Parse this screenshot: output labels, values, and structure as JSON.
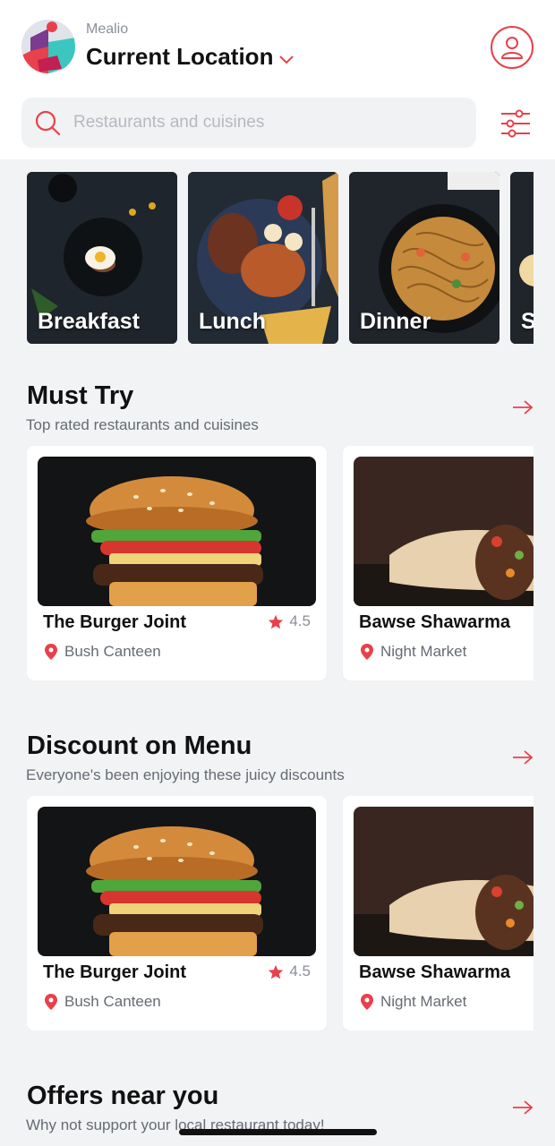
{
  "header": {
    "app_name": "Mealio",
    "location_label": "Current Location"
  },
  "search": {
    "placeholder": "Restaurants and cuisines"
  },
  "categories": [
    {
      "label": "Breakfast"
    },
    {
      "label": "Lunch"
    },
    {
      "label": "Dinner"
    },
    {
      "label": "S"
    }
  ],
  "must_try": {
    "title": "Must Try",
    "subtitle": "Top rated restaurants and cuisines",
    "cards": [
      {
        "name": "The Burger Joint",
        "rating": "4.5",
        "location": "Bush Canteen",
        "image": "burger"
      },
      {
        "name": "Bawse Shawarma",
        "location": "Night Market",
        "image": "shawarma"
      }
    ]
  },
  "discount": {
    "title": "Discount on Menu",
    "subtitle": "Everyone's been enjoying these juicy discounts",
    "cards": [
      {
        "name": "The Burger Joint",
        "rating": "4.5",
        "location": "Bush Canteen",
        "image": "burger"
      },
      {
        "name": "Bawse Shawarma",
        "location": "Night Market",
        "image": "shawarma"
      }
    ]
  },
  "offers": {
    "title": "Offers near you",
    "subtitle": "Why not support your local restaurant today!"
  },
  "colors": {
    "accent": "#e8414b",
    "background": "#f2f3f5",
    "card": "#ffffff"
  }
}
